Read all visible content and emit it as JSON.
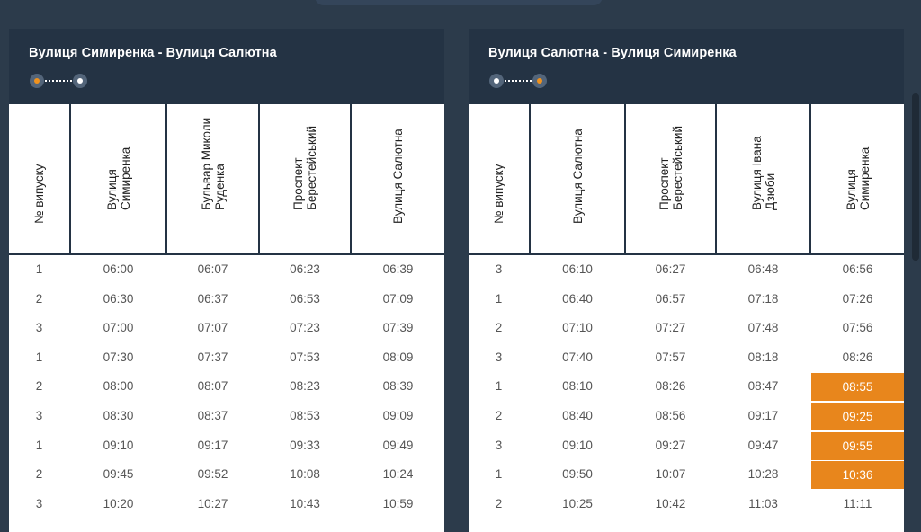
{
  "panels": [
    {
      "title": "Вулиця Симиренка - Вулиця Салютна",
      "active_dot": "start",
      "columns": [
        "№ випуску",
        "Вулиця\nСимиренка",
        "Бульвар Миколи\nРуденка",
        "Проспект\nБерестейський",
        "Вулиця Салютна"
      ],
      "rows": [
        [
          "1",
          "06:00",
          "06:07",
          "06:23",
          "06:39"
        ],
        [
          "2",
          "06:30",
          "06:37",
          "06:53",
          "07:09"
        ],
        [
          "3",
          "07:00",
          "07:07",
          "07:23",
          "07:39"
        ],
        [
          "1",
          "07:30",
          "07:37",
          "07:53",
          "08:09"
        ],
        [
          "2",
          "08:00",
          "08:07",
          "08:23",
          "08:39"
        ],
        [
          "3",
          "08:30",
          "08:37",
          "08:53",
          "09:09"
        ],
        [
          "1",
          "09:10",
          "09:17",
          "09:33",
          "09:49"
        ],
        [
          "2",
          "09:45",
          "09:52",
          "10:08",
          "10:24"
        ],
        [
          "3",
          "10:20",
          "10:27",
          "10:43",
          "10:59"
        ]
      ],
      "highlight_cells": []
    },
    {
      "title": "Вулиця Салютна - Вулиця Симиренка",
      "active_dot": "end",
      "columns": [
        "№ випуску",
        "Вулиця Салютна",
        "Проспект\nБерестейський",
        "Вулиця Івана\nДзюби",
        "Вулиця\nСимиренка"
      ],
      "rows": [
        [
          "3",
          "06:10",
          "06:27",
          "06:48",
          "06:56"
        ],
        [
          "1",
          "06:40",
          "06:57",
          "07:18",
          "07:26"
        ],
        [
          "2",
          "07:10",
          "07:27",
          "07:48",
          "07:56"
        ],
        [
          "3",
          "07:40",
          "07:57",
          "08:18",
          "08:26"
        ],
        [
          "1",
          "08:10",
          "08:26",
          "08:47",
          "08:55"
        ],
        [
          "2",
          "08:40",
          "08:56",
          "09:17",
          "09:25"
        ],
        [
          "3",
          "09:10",
          "09:27",
          "09:47",
          "09:55"
        ],
        [
          "1",
          "09:50",
          "10:07",
          "10:28",
          "10:36"
        ],
        [
          "2",
          "10:25",
          "10:42",
          "11:03",
          "11:11"
        ]
      ],
      "highlight_cells": [
        [
          4,
          4
        ],
        [
          5,
          4
        ],
        [
          6,
          4
        ],
        [
          7,
          4
        ]
      ]
    }
  ],
  "colors": {
    "background": "#2c3b4b",
    "header": "#243344",
    "highlight": "#e8861c",
    "active_dot": "#f0921e"
  }
}
